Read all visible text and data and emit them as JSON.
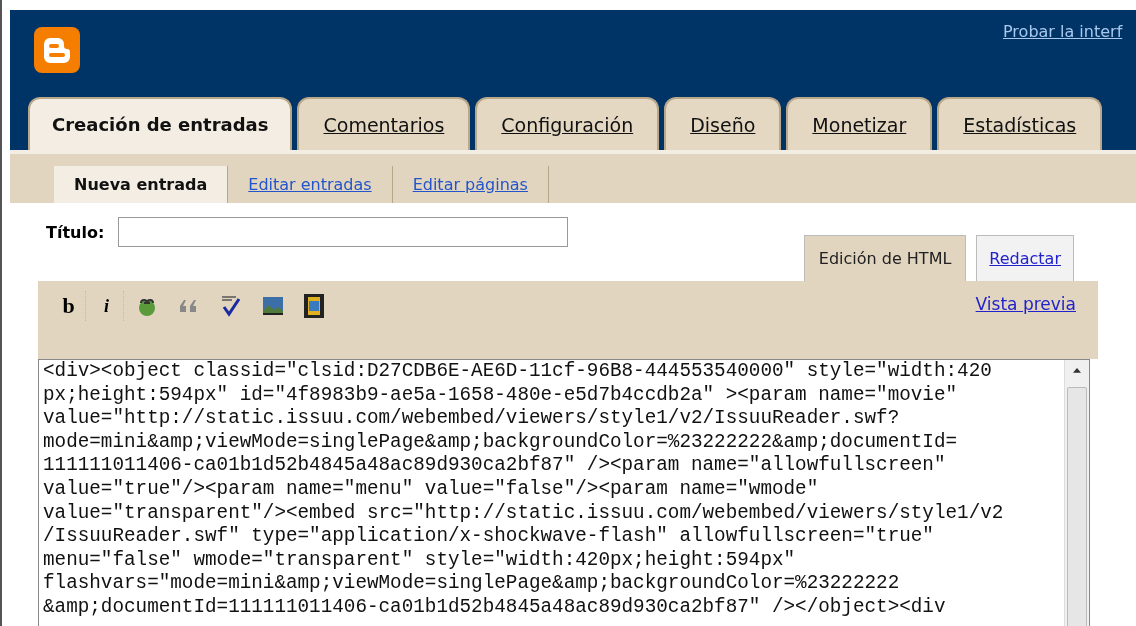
{
  "header": {
    "link": "Probar la interf"
  },
  "tabs": [
    {
      "label": "Creación de entradas",
      "selected": true
    },
    {
      "label": "Comentarios",
      "selected": false
    },
    {
      "label": "Configuración",
      "selected": false
    },
    {
      "label": "Diseño",
      "selected": false
    },
    {
      "label": "Monetizar",
      "selected": false
    },
    {
      "label": "Estadísticas",
      "selected": false
    }
  ],
  "subtabs": [
    {
      "label": "Nueva entrada",
      "selected": true
    },
    {
      "label": "Editar entradas",
      "selected": false
    },
    {
      "label": "Editar páginas",
      "selected": false
    }
  ],
  "title_field": {
    "label": "Título:"
  },
  "editor_tabs": [
    {
      "label": "Edición de HTML",
      "selected": true
    },
    {
      "label": "Redactar",
      "selected": false
    }
  ],
  "toolbar": [
    {
      "kind": "bold",
      "label": "b"
    },
    {
      "kind": "italic",
      "label": "i"
    },
    {
      "kind": "link"
    },
    {
      "kind": "quote"
    },
    {
      "kind": "spellcheck"
    },
    {
      "kind": "image"
    },
    {
      "kind": "video"
    }
  ],
  "preview_link": "Vista previa",
  "editor_lines": [
    "<div><object classid=\"clsid:D27CDB6E-AE6D-11cf-96B8-444553540000\" style=\"width:420",
    "px;height:594px\" id=\"4f8983b9-ae5a-1658-480e-e5d7b4ccdb2a\" ><param name=\"movie\"",
    "value=\"http://static.issuu.com/webembed/viewers/style1/v2/IssuuReader.swf?",
    "mode=mini&amp;viewMode=singlePage&amp;backgroundColor=%23222222&amp;documentId=",
    "111111011406-ca01b1d52b4845a48ac89d930ca2bf87\" /><param name=\"allowfullscreen\"",
    "value=\"true\"/><param name=\"menu\" value=\"false\"/><param name=\"wmode\"",
    "value=\"transparent\"/><embed src=\"http://static.issuu.com/webembed/viewers/style1/v2",
    "/IssuuReader.swf\" type=\"application/x-shockwave-flash\" allowfullscreen=\"true\"",
    "menu=\"false\" wmode=\"transparent\" style=\"width:420px;height:594px\"",
    "flashvars=\"mode=mini&amp;viewMode=singlePage&amp;backgroundColor=%23222222",
    "&amp;documentId=111111011406-ca01b1d52b4845a48ac89d930ca2bf87\" /></object><div"
  ]
}
